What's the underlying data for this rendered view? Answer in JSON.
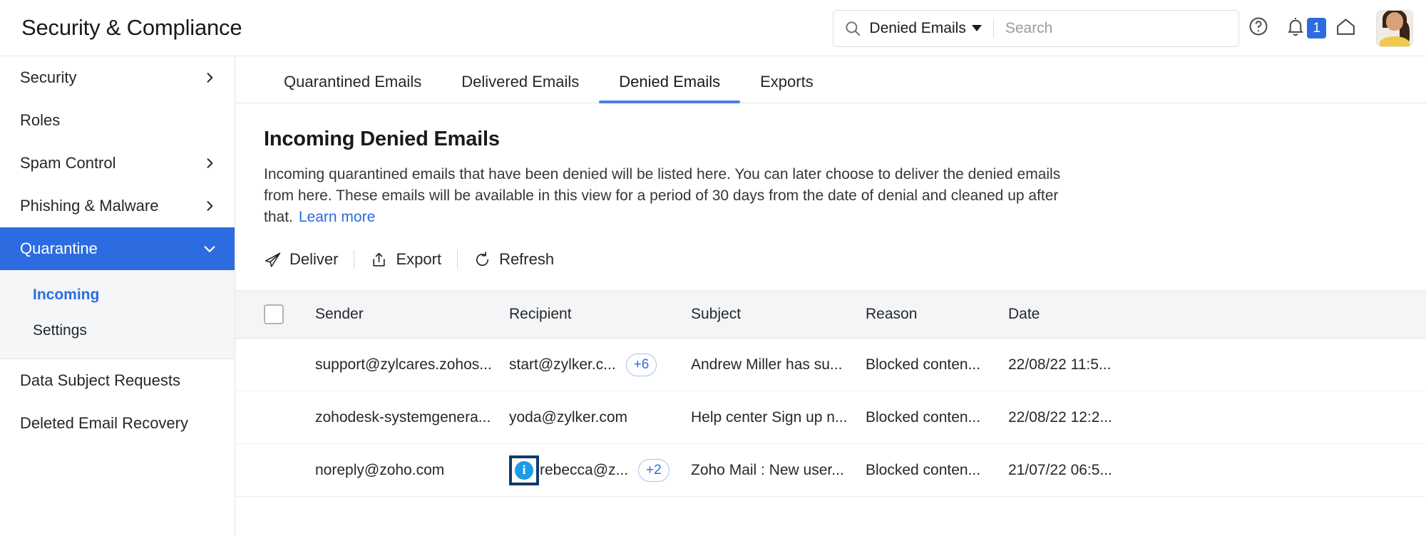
{
  "header": {
    "title": "Security & Compliance",
    "search": {
      "scope": "Denied Emails",
      "placeholder": "Search",
      "value": "",
      "search_icon": "search-icon",
      "caret_icon": "chevron-down-icon"
    },
    "help_icon": "help-circle-icon",
    "bell_icon": "bell-icon",
    "notification_count": "1",
    "home_icon": "home-icon",
    "avatar": "user-avatar"
  },
  "sidebar": {
    "items": [
      {
        "label": "Security",
        "chevron": "chevron-right-icon",
        "expandable": true,
        "active": false
      },
      {
        "label": "Roles",
        "chevron": "",
        "expandable": false,
        "active": false
      },
      {
        "label": "Spam Control",
        "chevron": "chevron-right-icon",
        "expandable": true,
        "active": false
      },
      {
        "label": "Phishing & Malware",
        "chevron": "chevron-right-icon",
        "expandable": true,
        "active": false
      },
      {
        "label": "Quarantine",
        "chevron": "chevron-down-icon",
        "expandable": true,
        "active": true
      }
    ],
    "subitems": [
      {
        "label": "Incoming",
        "current": true
      },
      {
        "label": "Settings",
        "current": false
      }
    ],
    "items_after": [
      {
        "label": "Data Subject Requests"
      },
      {
        "label": "Deleted Email Recovery"
      }
    ]
  },
  "tabs": [
    {
      "label": "Quarantined Emails",
      "active": false
    },
    {
      "label": "Delivered Emails",
      "active": false
    },
    {
      "label": "Denied Emails",
      "active": true
    },
    {
      "label": "Exports",
      "active": false
    }
  ],
  "page": {
    "title": "Incoming Denied Emails",
    "description": "Incoming quarantined emails that have been denied will be listed here. You can later choose to deliver the denied emails from here. These emails will be available in this view for a period of 30 days from the date of denial and cleaned up after that.",
    "learn_more": "Learn more"
  },
  "toolbar": {
    "deliver_label": "Deliver",
    "deliver_icon": "paper-plane-icon",
    "export_label": "Export",
    "export_icon": "upload-box-icon",
    "refresh_label": "Refresh",
    "refresh_icon": "refresh-icon"
  },
  "table": {
    "columns": [
      "Sender",
      "Recipient",
      "Subject",
      "Reason",
      "Date"
    ],
    "rows": [
      {
        "sender": "support@zylcares.zohos...",
        "recipient": "start@zylker.c...",
        "recipient_more": "+6",
        "subject": "Andrew Miller has su...",
        "reason": "Blocked conten...",
        "date": "22/08/22 11:5...",
        "info_highlighted": false
      },
      {
        "sender": "zohodesk-systemgenera...",
        "recipient": "yoda@zylker.com",
        "recipient_more": "",
        "subject": "Help center Sign up n...",
        "reason": "Blocked conten...",
        "date": "22/08/22 12:2...",
        "info_highlighted": false
      },
      {
        "sender": "noreply@zoho.com",
        "recipient": "rebecca@z...",
        "recipient_more": "+2",
        "subject": "Zoho Mail : New user...",
        "reason": "Blocked conten...",
        "date": "21/07/22 06:5...",
        "info_highlighted": true,
        "info_icon": "info-icon"
      }
    ]
  },
  "colors": {
    "accent": "#2d6ce0",
    "tab_underline": "#4a7ee8",
    "header_row_bg": "#f4f5f6",
    "subgroup_bg": "#f4f6f8",
    "info_icon": "#1e9ae8",
    "focus_outline": "#123a6b"
  }
}
